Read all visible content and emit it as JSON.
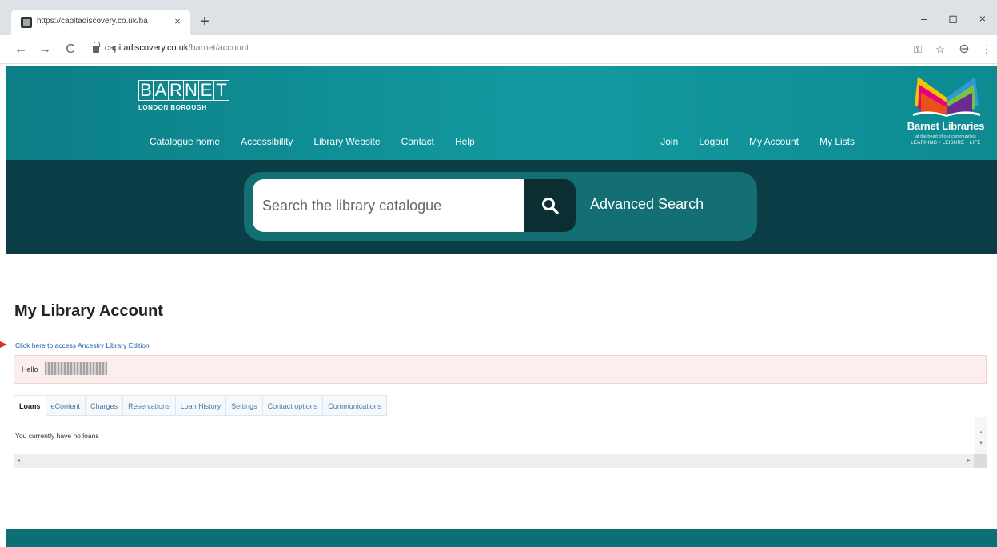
{
  "browser": {
    "tab_title": "https://capitadiscovery.co.uk/ba",
    "tab_close": "×",
    "new_tab": "+",
    "url_host": "capitadiscovery.co.uk",
    "url_path": "/barnet/account",
    "controls": {
      "back": "←",
      "forward": "→",
      "reload": "C",
      "minimize": "–",
      "maximize": "◻",
      "close": "×"
    },
    "addr_icons": {
      "key": "⚿",
      "star": "☆",
      "profile": "⊖",
      "menu": "⋮"
    }
  },
  "site": {
    "logo_letters": [
      "B",
      "A",
      "R",
      "N",
      "E",
      "T"
    ],
    "logo_sub": "LONDON BOROUGH",
    "nav_left": [
      "Catalogue home",
      "Accessibility",
      "Library Website",
      "Contact",
      "Help"
    ],
    "nav_right": [
      "Join",
      "Logout",
      "My Account",
      "My Lists"
    ],
    "brand_name": "Barnet Libraries",
    "brand_tagline": "at the heart of our communities",
    "brand_tagline2": "LEARNING • LEISURE • LIFE",
    "colors": {
      "header": "#129aa0",
      "searchband": "#0a3d46",
      "footer": "#0c6f76",
      "alert_bg": "#fbeeec",
      "link": "#1a5ea8"
    }
  },
  "search": {
    "placeholder": "Search the library catalogue",
    "icon": "search-icon",
    "advanced_label": "Advanced Search"
  },
  "account": {
    "title": "My Library Account",
    "ancestry_link": "Click here to access Ancestry Library Edition",
    "hello_label": "Hello",
    "tabs": [
      "Loans",
      "eContent",
      "Charges",
      "Reservations",
      "Loan History",
      "Settings",
      "Contact options",
      "Communications"
    ],
    "active_tab": "Loans",
    "loans_message": "You currently have no loans"
  },
  "scrollbar": {
    "left": "◂",
    "right": "▸",
    "up": "▴",
    "down": "▾"
  }
}
